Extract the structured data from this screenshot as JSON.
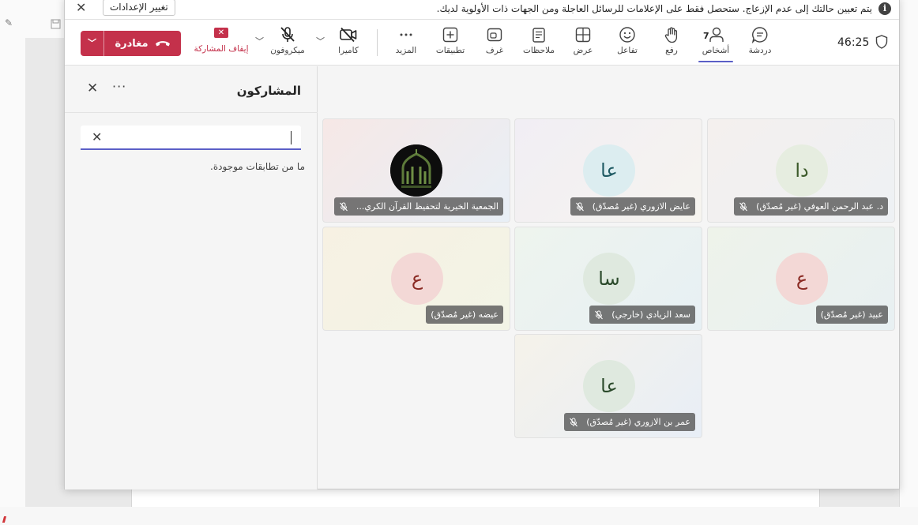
{
  "notice": {
    "text": "يتم تعيين حالتك إلى عدم الإزعاج. ستحصل فقط على الإعلامات للرسائل العاجلة ومن الجهات ذات الأولوية لديك.",
    "settings_button": "تغيير الإعدادات"
  },
  "toolbar": {
    "timer": "46:25",
    "participant_count": "7",
    "chat": "دردشة",
    "people": "أشخاص",
    "raise": "رفع",
    "react": "تفاعل",
    "view": "عرض",
    "notes": "ملاحظات",
    "rooms": "غرف",
    "apps": "تطبيقات",
    "more": "المزيد",
    "camera": "كاميرا",
    "mic": "ميكروفون",
    "stop_sharing": "إيقاف المشاركة",
    "leave": "مغادرة"
  },
  "panel": {
    "title": "المشاركون",
    "more": "···",
    "no_match": "ما من تطابقات موجودة."
  },
  "tiles": [
    {
      "initials": "دا",
      "name": "د. عبد الرحمن العوفي (غير مُصدّق)",
      "avatar_bg": "#e6ede0",
      "avatar_fg": "#3c5a2a"
    },
    {
      "initials": "عا",
      "name": "عايض الازوري (غير مُصدّق)",
      "avatar_bg": "#dcedf0",
      "avatar_fg": "#1f5a63"
    },
    {
      "initials": "",
      "name": "الجمعية الخيرية لتحفيظ القرآن الكري...",
      "avatar_bg": "#111111",
      "avatar_fg": "#ffffff"
    },
    {
      "initials": "ع",
      "name": "عبيد (غير مُصدّق)",
      "avatar_bg": "#f3d8d6",
      "avatar_fg": "#8a2a23"
    },
    {
      "initials": "سا",
      "name": "سعد الزيادي (خارجي)",
      "avatar_bg": "#dfe9df",
      "avatar_fg": "#2b4a2b"
    },
    {
      "initials": "ع",
      "name": "عيضه (غير مُصدّق)",
      "avatar_bg": "#f3d8d6",
      "avatar_fg": "#8a2a23"
    },
    {
      "initials": "عا",
      "name": "عمر بن الازوري (غير مُصدّق)",
      "avatar_bg": "#dfe9df",
      "avatar_fg": "#2b4a2b"
    }
  ]
}
